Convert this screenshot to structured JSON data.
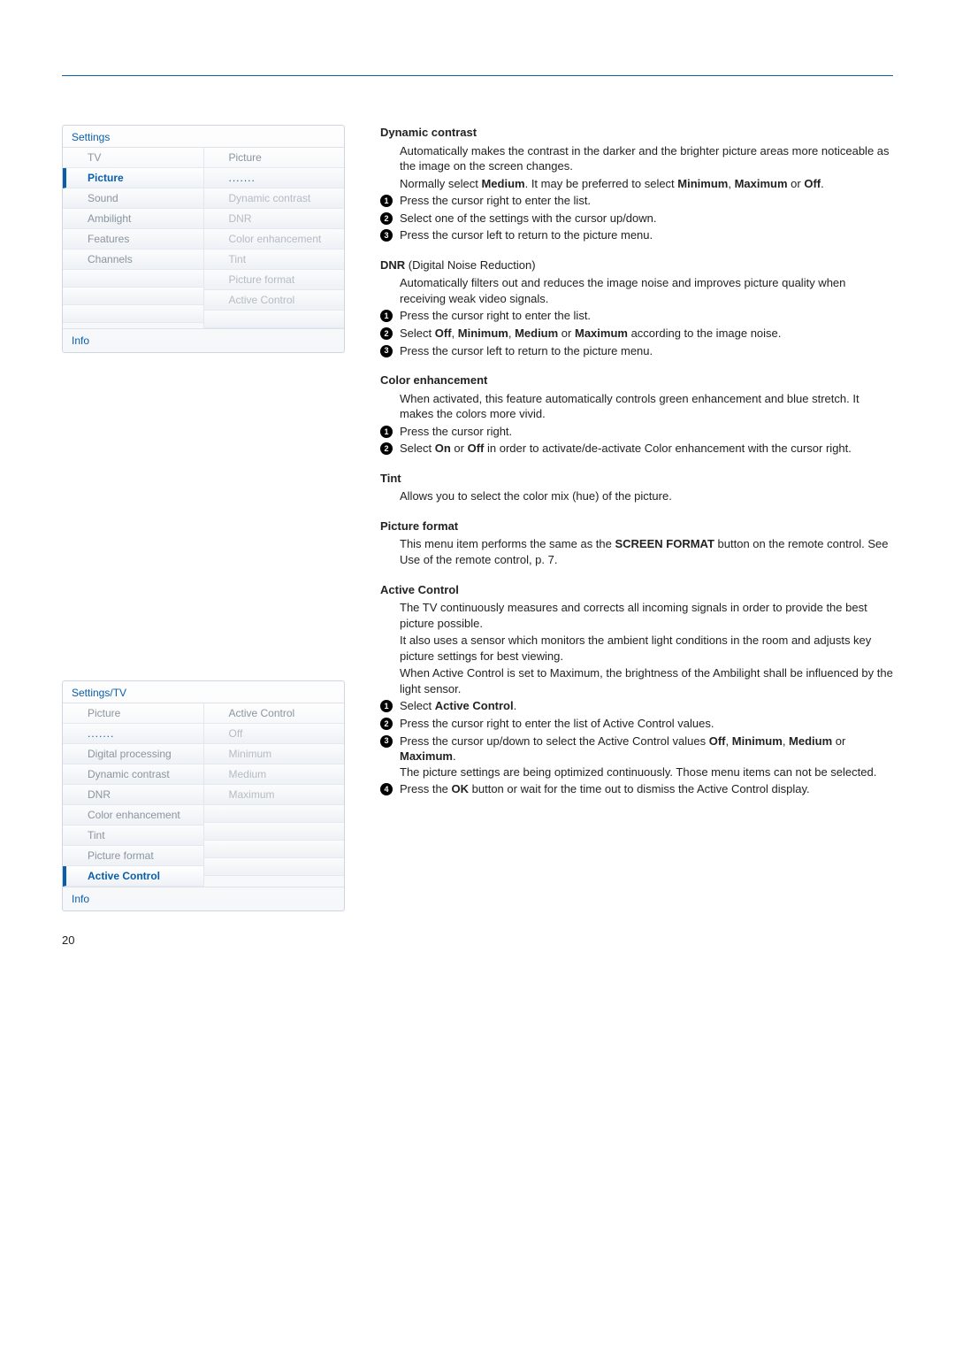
{
  "page_number": "20",
  "menu1": {
    "title": "Settings",
    "left_header": "TV",
    "left_items": [
      "Picture",
      "Sound",
      "Ambilight",
      "Features",
      "Channels"
    ],
    "left_selected_index": 0,
    "right_header": "Picture",
    "right_items": [
      "",
      "Dynamic contrast",
      "DNR",
      "Color enhancement",
      "Tint",
      "Picture format",
      "Active Control"
    ],
    "footer": "Info"
  },
  "menu2": {
    "title": "Settings/TV",
    "left_header": "Picture",
    "left_items": [
      "",
      "Digital processing",
      "Dynamic contrast",
      "DNR",
      "Color enhancement",
      "Tint",
      "Picture format",
      "Active Control"
    ],
    "left_selected_index": 7,
    "right_header": "Active Control",
    "right_items": [
      "Off",
      "Minimum",
      "Medium",
      "Maximum"
    ],
    "footer": "Info"
  },
  "sections": {
    "dyn": {
      "title": "Dynamic contrast",
      "p1a": "Automatically makes the contrast in the darker and the brighter picture areas more noticeable as the image on the screen changes.",
      "p1b_pre": "Normally select ",
      "p1b_b1": "Medium",
      "p1b_mid": ". It may be preferred to select ",
      "p1b_b2": "Minimum",
      "p1b_sep": ", ",
      "p1b_b3": "Maximum",
      "p1b_or": " or ",
      "p1b_b4": "Off",
      "p1b_end": ".",
      "s1": "Press the cursor right to enter the list.",
      "s2": "Select one of the settings with the cursor up/down.",
      "s3": "Press the cursor left to return to the picture menu."
    },
    "dnr": {
      "title": "DNR",
      "suffix": " (Digital Noise Reduction)",
      "p1": "Automatically filters out and reduces the image noise and improves picture quality when receiving weak video signals.",
      "s1": "Press the cursor right to enter the list.",
      "s2_pre": "Select ",
      "s2_b1": "Off",
      "s2_c1": ", ",
      "s2_b2": "Minimum",
      "s2_c2": ", ",
      "s2_b3": "Medium",
      "s2_or": " or ",
      "s2_b4": "Maximum",
      "s2_post": " according to the image noise.",
      "s3": "Press the cursor left to return to the picture menu."
    },
    "color": {
      "title": "Color enhancement",
      "p1": "When activated, this feature automatically controls green enhancement and blue stretch. It makes the colors more vivid.",
      "s1": "Press the cursor right.",
      "s2_pre": "Select ",
      "s2_b1": "On",
      "s2_or": " or ",
      "s2_b2": "Off",
      "s2_post": " in order to activate/de-activate Color enhancement with the cursor right."
    },
    "tint": {
      "title": "Tint",
      "p1": "Allows you to select the color mix (hue) of the picture."
    },
    "pf": {
      "title": "Picture format",
      "p1_pre": "This menu item performs the same as the ",
      "p1_b": "SCREEN FORMAT",
      "p1_post": " button on the remote control. See Use of the remote control, p. 7."
    },
    "ac": {
      "title": "Active Control",
      "p1": "The TV continuously measures and corrects all incoming signals in order to provide the best picture possible.",
      "p2": "It also uses a sensor which monitors the ambient light conditions in the room and adjusts key picture settings for best viewing.",
      "p3": "When Active Control is set to Maximum, the brightness of the Ambilight shall be influenced by the light sensor.",
      "s1_pre": "Select ",
      "s1_b": "Active Control",
      "s1_post": ".",
      "s2": "Press the cursor right to enter the list of Active Control values.",
      "s3_pre": "Press the cursor up/down to select the Active Control values ",
      "s3_b1": "Off",
      "s3_c1": ", ",
      "s3_b2": "Minimum",
      "s3_c2": ", ",
      "s3_b3": "Medium",
      "s3_or": " or ",
      "s3_b4": "Maximum",
      "s3_end": ".",
      "s3_extra": "The picture settings are being optimized continuously. Those menu items can not be selected.",
      "s4_pre": "Press the ",
      "s4_b": "OK",
      "s4_post": " button or wait for the time out to dismiss the Active Control display."
    }
  }
}
